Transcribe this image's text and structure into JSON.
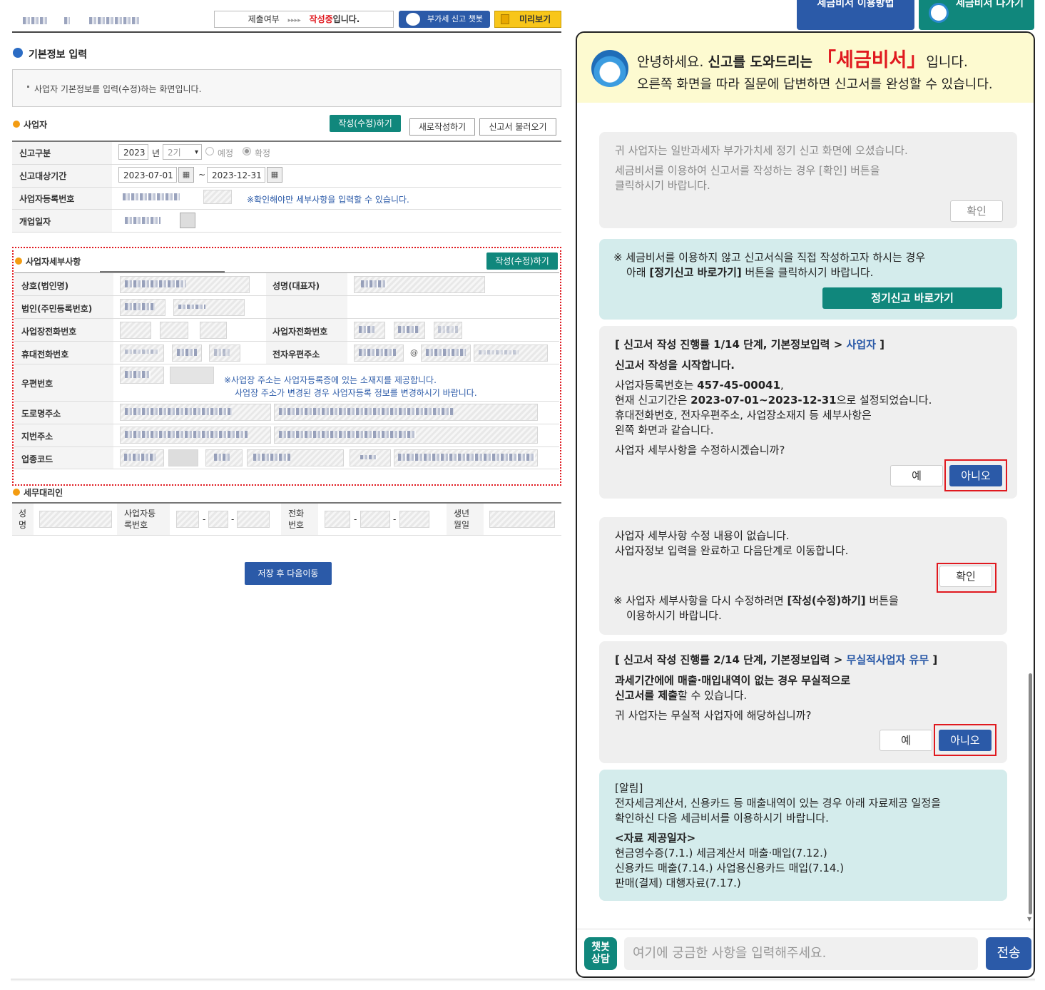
{
  "header": {
    "status_prefix": "제출여부",
    "status_arrows": "▸▸▸▸",
    "status_state": "작성중",
    "status_suffix": "입니다.",
    "chatbot_button": "부가세 신고 챗봇",
    "preview_button": "미리보기"
  },
  "chat_tabs": {
    "guide": "세금비서 이용방법",
    "exit": "세금비서 나가기"
  },
  "basic_info": {
    "section_title": "기본정보 입력",
    "notice": "사업자 기본정보를 입력(수정)하는 화면입니다."
  },
  "business": {
    "title": "사업자",
    "edit_button": "작성(수정)하기",
    "new_button": "새로작성하기",
    "load_button": "신고서 불러오기",
    "report_type_label": "신고구분",
    "year": "2023",
    "year_unit": "년",
    "period": "2기",
    "radio_preliminary": "예정",
    "radio_final": "확정",
    "period_label": "신고대상기간",
    "date_from": "2023-07-01",
    "date_sep": "~",
    "date_to": "2023-12-31",
    "reg_no_label": "사업자등록번호",
    "reg_no_hint": "※확인해야만 세부사항을 입력할 수 있습니다.",
    "open_date_label": "개업일자"
  },
  "detail": {
    "title": "사업자세부사항",
    "edit_button": "작성(수정)하기",
    "name_label": "상호(법인명)",
    "rep_label": "성명(대표자)",
    "corp_no_label": "법인(주민등록번호)",
    "biz_phone_label": "사업장전화번호",
    "biz_phone2_label": "사업자전화번호",
    "mobile_label": "휴대전화번호",
    "email_label": "전자우편주소",
    "zip_label": "우편번호",
    "zip_hint1": "※사업장 주소는 사업자등록증에 있는 소재지를 제공합니다.",
    "zip_hint2": "사업장 주소가 변경된 경우 사업자등록 정보를 변경하시기 바랍니다.",
    "road_label": "도로명주소",
    "lot_label": "지번주소",
    "industry_label": "업종코드"
  },
  "agent": {
    "title": "세무대리인",
    "name_label": "성명",
    "reg_label": "사업자등록번호",
    "phone_label": "전화번호",
    "birth_label": "생년월일",
    "dash": "-"
  },
  "save_button": "저장 후 다음이동",
  "chat": {
    "greeting_1": "안녕하세요.",
    "greeting_2": "신고를 도와드리는",
    "greeting_name": "「세금비서」",
    "greeting_3": "입니다.",
    "greeting_line2": "오른쪽 화면을 따라 질문에 답변하면 신고서를 완성할 수 있습니다.",
    "msg1_l1": "귀 사업자는 일반과세자 부가가치세 정기 신고 화면에 오셨습니다.",
    "msg1_l2": "세금비서를 이용하여 신고서를 작성하는 경우 [확인] 버튼을",
    "msg1_l3": "클릭하시기 바랍니다.",
    "msg1_button": "확인",
    "msg2_l1": "※ 세금비서를 이용하지 않고 신고서식을 직접 작성하고자 하시는 경우",
    "msg2_l2a": "아래",
    "msg2_l2b": "[정기신고 바로가기]",
    "msg2_l2c": "버튼을 클릭하시기 바랍니다.",
    "msg2_button": "정기신고 바로가기",
    "msg3_step": "[ 신고서 작성 진행률 1/14 단계, 기본정보입력 >",
    "msg3_step_link": "사업자",
    "msg3_step_end": "]",
    "msg3_title": "신고서 작성을 시작합니다.",
    "msg3_l1a": "사업자등록번호는",
    "msg3_l1b": "457-45-00041",
    "msg3_l1c": ",",
    "msg3_l2a": "현재 신고기간은",
    "msg3_l2b": "2023-07-01~2023-12-31",
    "msg3_l2c": "으로 설정되었습니다.",
    "msg3_l3": "휴대전화번호, 전자우편주소, 사업장소재지 등 세부사항은",
    "msg3_l4": "왼쪽 화면과 같습니다.",
    "msg3_question": "사업자 세부사항을 수정하시겠습니까?",
    "yes": "예",
    "no": "아니오",
    "msg4_l1": "사업자 세부사항 수정 내용이 없습니다.",
    "msg4_l2": "사업자정보 입력을 완료하고 다음단계로 이동합니다.",
    "msg4_button": "확인",
    "msg4_n1a": "※ 사업자 세부사항을 다시 수정하려면",
    "msg4_n1b": "[작성(수정)하기]",
    "msg4_n1c": "버튼을",
    "msg4_n2": "이용하시기 바랍니다.",
    "msg5_step": "[ 신고서 작성 진행률 2/14 단계, 기본정보입력 >",
    "msg5_step_link": "무실적사업자 유무",
    "msg5_step_end": "]",
    "msg5_t1": "과세기간에에 매출·매입내역이 없는 경우 무실적으로",
    "msg5_t2a": "신고서를 제출",
    "msg5_t2b": "할 수 있습니다.",
    "msg5_question": "귀 사업자는 무실적 사업자에 해당하십니까?",
    "msg6_title": "[알림]",
    "msg6_l1": "전자세금계산서, 신용카드 등 매출내역이 있는 경우 아래 자료제공 일정을",
    "msg6_l2": "확인하신 다음 세금비서를 이용하시기 바랍니다.",
    "msg6_sub": "<자료 제공일자>",
    "msg6_l3": "현금영수증(7.1.) 세금계산서 매출·매입(7.12.)",
    "msg6_l4": "신용카드 매출(7.14.) 사업용신용카드 매입(7.14.)",
    "msg6_l5": "판매(결제) 대행자료(7.17.)",
    "badge": "챗봇상담",
    "input_placeholder": "여기에 궁금한 사항을 입력해주세요.",
    "send": "전송"
  },
  "colors": {
    "teal": "#10877c",
    "blue": "#2b5aa8",
    "red": "#e0191f",
    "chat_header_bg": "#fdfad0"
  }
}
